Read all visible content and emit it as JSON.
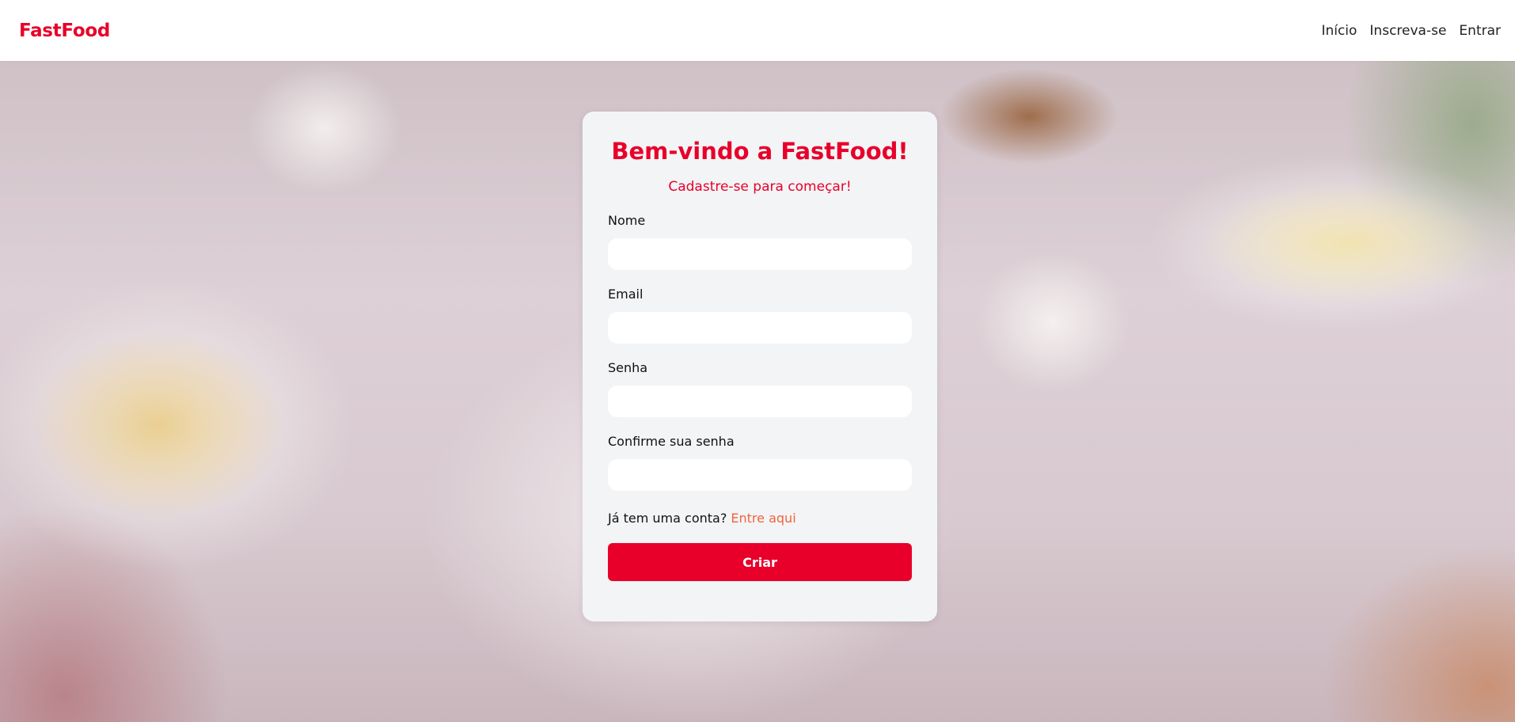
{
  "navbar": {
    "brand": "FastFood",
    "links": [
      "Início",
      "Inscreva-se",
      "Entrar"
    ]
  },
  "signup_card": {
    "title": "Bem-vindo a FastFood!",
    "subtitle": "Cadastre-se para começar!",
    "fields": [
      {
        "label": "Nome",
        "value": "",
        "placeholder": ""
      },
      {
        "label": "Email",
        "value": "",
        "placeholder": ""
      },
      {
        "label": "Senha",
        "value": "",
        "placeholder": ""
      },
      {
        "label": "Confirme sua senha",
        "value": "",
        "placeholder": ""
      }
    ],
    "login_prompt": "Já tem uma conta?",
    "login_link": "Entre aqui",
    "submit_label": "Criar"
  },
  "colors": {
    "brand_red": "#e8002a",
    "link_orange": "#f0643c",
    "card_background": "#f3f4f6"
  }
}
